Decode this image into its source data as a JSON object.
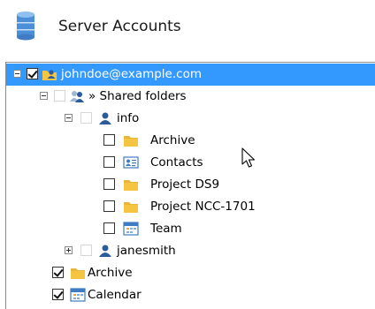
{
  "header": {
    "title": "Server Accounts",
    "icon": "database-icon"
  },
  "tree": {
    "account": "johndoe@example.com",
    "shared_folders": "» Shared folders",
    "users": [
      {
        "name": "info",
        "items": [
          {
            "label": "Archive",
            "icon": "folder-icon",
            "checked": false
          },
          {
            "label": "Contacts",
            "icon": "contacts-icon",
            "checked": false
          },
          {
            "label": "Project DS9",
            "icon": "folder-icon",
            "checked": false
          },
          {
            "label": "Project NCC-1701",
            "icon": "folder-icon",
            "checked": false
          },
          {
            "label": "Team",
            "icon": "calendar-icon",
            "checked": false
          }
        ]
      },
      {
        "name": "janesmith",
        "collapsed": true
      }
    ],
    "folders": [
      {
        "label": "Archive",
        "icon": "folder-icon",
        "checked": true
      },
      {
        "label": "Calendar",
        "icon": "calendar-icon",
        "checked": true
      }
    ]
  },
  "colors": {
    "selection": "#3399ff",
    "folder": "#f5c542",
    "user": "#2b5b9a"
  }
}
